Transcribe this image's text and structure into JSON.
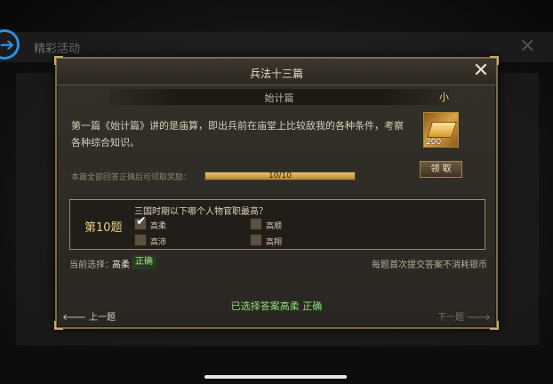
{
  "background": {
    "title": "精彩活动",
    "back_icon": "back-arrow-icon",
    "close_icon": "close-icon"
  },
  "dialog": {
    "title": "兵法十三篇",
    "close_glyph": "✕",
    "chapter_name": "始计篇",
    "chapter_extra": "小",
    "description": "第一篇《始计篇》讲的是庙算，即出兵前在庙堂上比较敌我的各种条件，考察各种综合知识。",
    "reward": {
      "icon": "gold-bar-icon",
      "count": "200"
    },
    "claim_label": "领 取",
    "progress": {
      "label": "本篇全部回答正确后可领取奖励：",
      "text": "10/10",
      "fraction": 1.0
    },
    "quiz": {
      "number": "第10题",
      "question": "三国时期以下哪个人物官职最高？",
      "options": [
        {
          "label": "高柔",
          "checked": true
        },
        {
          "label": "高顺",
          "checked": false
        },
        {
          "label": "高沛",
          "checked": false
        },
        {
          "label": "高翔",
          "checked": false
        }
      ]
    },
    "current_label": "当前选择：",
    "current_answer": "高柔",
    "current_status": "正确",
    "notice": "每题首次提交答案不消耗银币",
    "result": "已选择答案高柔 正确",
    "prev_label": "上一题",
    "next_label": "下一题"
  },
  "colors": {
    "gold": "#c9ab70",
    "correct_green": "#8ee07a",
    "back_blue": "#2d8fe0"
  }
}
